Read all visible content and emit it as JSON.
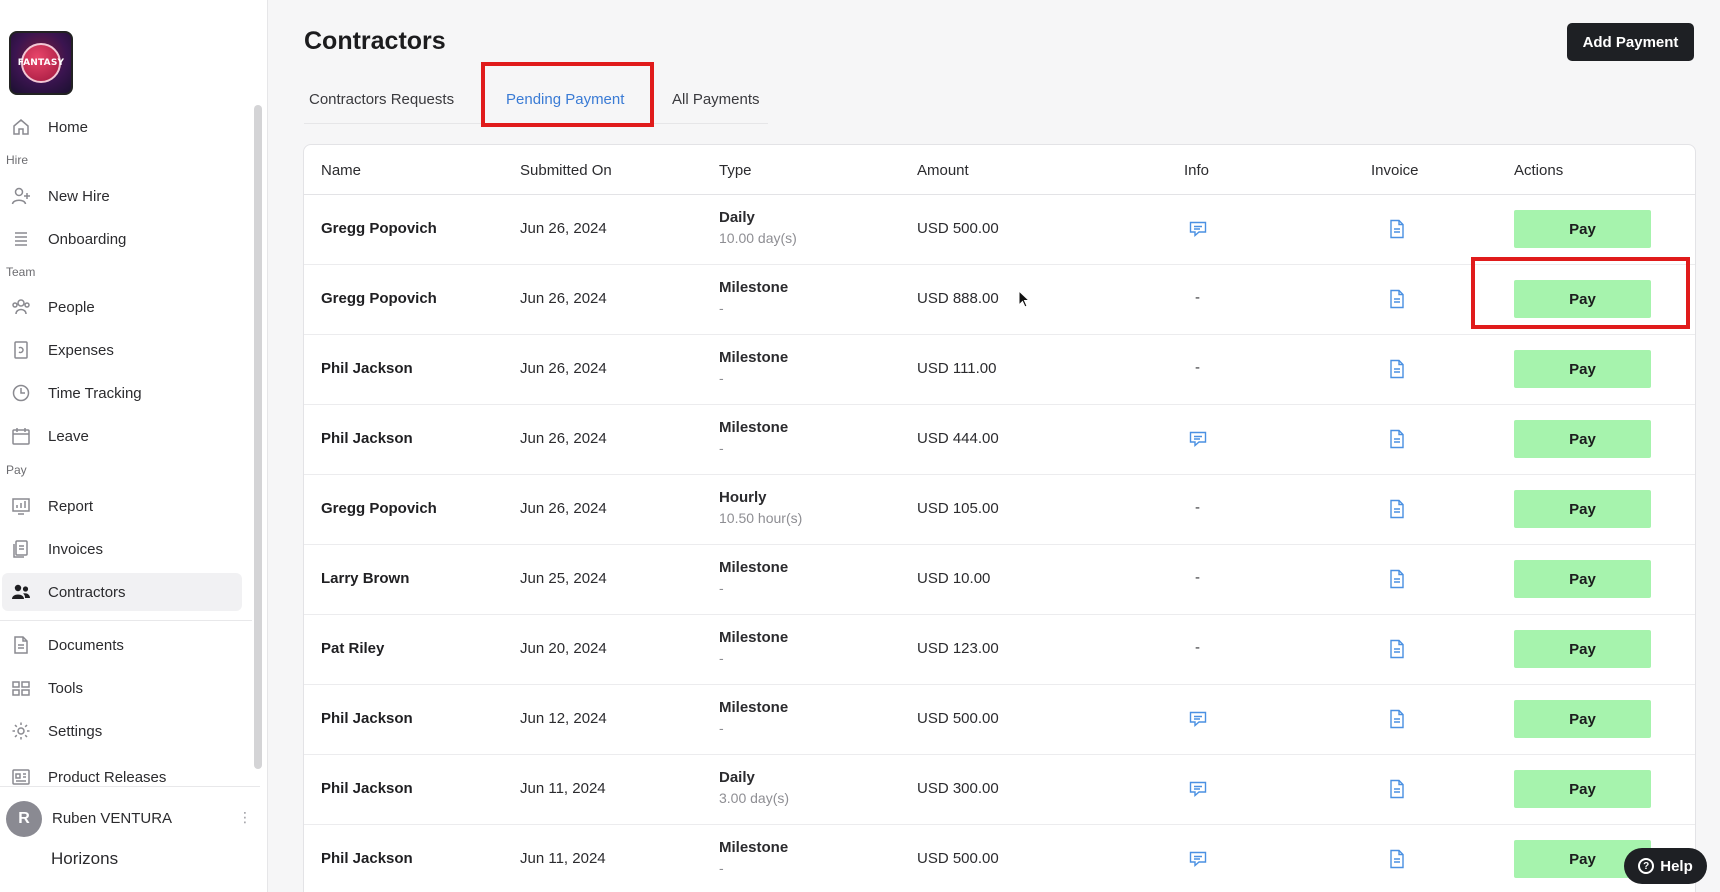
{
  "sidebar": {
    "logo_text": "FANTASY",
    "items": [
      {
        "label": "Home",
        "icon": "home-icon"
      },
      {
        "label": "New Hire",
        "icon": "user-plus-icon"
      },
      {
        "label": "Onboarding",
        "icon": "list-icon"
      },
      {
        "label": "People",
        "icon": "people-icon"
      },
      {
        "label": "Expenses",
        "icon": "receipt-icon"
      },
      {
        "label": "Time Tracking",
        "icon": "clock-icon"
      },
      {
        "label": "Leave",
        "icon": "calendar-icon"
      },
      {
        "label": "Report",
        "icon": "chart-icon"
      },
      {
        "label": "Invoices",
        "icon": "invoice-icon"
      },
      {
        "label": "Contractors",
        "icon": "contractors-icon"
      },
      {
        "label": "Documents",
        "icon": "document-icon"
      },
      {
        "label": "Tools",
        "icon": "tools-icon"
      },
      {
        "label": "Settings",
        "icon": "gear-icon"
      },
      {
        "label": "Product Releases",
        "icon": "releases-icon"
      }
    ],
    "sections": {
      "hire": "Hire",
      "team": "Team",
      "pay": "Pay"
    },
    "active": "Contractors",
    "user": {
      "initial": "R",
      "name": "Ruben VENTURA",
      "company": "Horizons"
    }
  },
  "header": {
    "title": "Contractors",
    "add_button": "Add Payment"
  },
  "tabs": [
    {
      "label": "Contractors Requests"
    },
    {
      "label": "Pending Payment"
    },
    {
      "label": "All Payments"
    }
  ],
  "active_tab": "Pending Payment",
  "table": {
    "columns": [
      "Name",
      "Submitted On",
      "Type",
      "Amount",
      "Info",
      "Invoice",
      "Actions"
    ],
    "rows": [
      {
        "name": "Gregg Popovich",
        "date": "Jun 26, 2024",
        "type": "Daily",
        "detail": "10.00 day(s)",
        "amount": "USD 500.00",
        "info": "comment",
        "action": "Pay"
      },
      {
        "name": "Gregg Popovich",
        "date": "Jun 26, 2024",
        "type": "Milestone",
        "detail": "-",
        "amount": "USD 888.00",
        "info": "-",
        "action": "Pay"
      },
      {
        "name": "Phil Jackson",
        "date": "Jun 26, 2024",
        "type": "Milestone",
        "detail": "-",
        "amount": "USD 111.00",
        "info": "-",
        "action": "Pay"
      },
      {
        "name": "Phil Jackson",
        "date": "Jun 26, 2024",
        "type": "Milestone",
        "detail": "-",
        "amount": "USD 444.00",
        "info": "comment",
        "action": "Pay"
      },
      {
        "name": "Gregg Popovich",
        "date": "Jun 26, 2024",
        "type": "Hourly",
        "detail": "10.50 hour(s)",
        "amount": "USD 105.00",
        "info": "-",
        "action": "Pay"
      },
      {
        "name": "Larry Brown",
        "date": "Jun 25, 2024",
        "type": "Milestone",
        "detail": "-",
        "amount": "USD 10.00",
        "info": "-",
        "action": "Pay"
      },
      {
        "name": "Pat Riley",
        "date": "Jun 20, 2024",
        "type": "Milestone",
        "detail": "-",
        "amount": "USD 123.00",
        "info": "-",
        "action": "Pay"
      },
      {
        "name": "Phil Jackson",
        "date": "Jun 12, 2024",
        "type": "Milestone",
        "detail": "-",
        "amount": "USD 500.00",
        "info": "comment",
        "action": "Pay"
      },
      {
        "name": "Phil Jackson",
        "date": "Jun 11, 2024",
        "type": "Daily",
        "detail": "3.00 day(s)",
        "amount": "USD 300.00",
        "info": "comment",
        "action": "Pay"
      },
      {
        "name": "Phil Jackson",
        "date": "Jun 11, 2024",
        "type": "Milestone",
        "detail": "-",
        "amount": "USD 500.00",
        "info": "comment",
        "action": "Pay"
      }
    ]
  },
  "help_button": "Help",
  "colors": {
    "pay_button": "#a6f3ad",
    "active_tab": "#3a7bd5",
    "highlight": "#e01b1b",
    "dark_button": "#1e2024"
  }
}
